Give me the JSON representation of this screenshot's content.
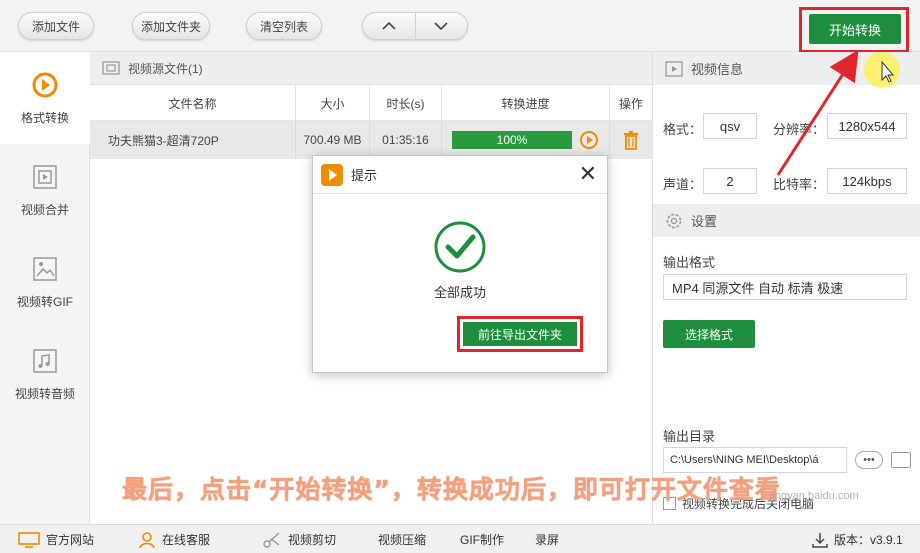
{
  "toolbar": {
    "add_file": "添加文件",
    "add_folder": "添加文件夹",
    "clear_list": "清空列表",
    "up_arrow": "︿",
    "down_arrow": "﹀",
    "start_convert": "开始转换"
  },
  "nav": {
    "items": [
      {
        "label": "格式转换",
        "icon": "play-circle-icon"
      },
      {
        "label": "视频合并",
        "icon": "video-merge-icon"
      },
      {
        "label": "视频转GIF",
        "icon": "image-icon"
      },
      {
        "label": "视频转音频",
        "icon": "music-note-icon"
      }
    ]
  },
  "files": {
    "header": "视频源文件(1)",
    "columns": [
      "文件名称",
      "大小",
      "时长(s)",
      "转换进度",
      "操作"
    ],
    "rows": [
      {
        "name": "功夫熊猫3-超清720P",
        "size": "700.49 MB",
        "duration": "01:35:16",
        "progress": "100%",
        "progress_value": 100
      }
    ]
  },
  "video_info": {
    "header": "视频信息",
    "format_label": "格式：",
    "format_value": "qsv",
    "resolution_label": "分辨率：",
    "resolution_value": "1280x544",
    "channel_label": "声道：",
    "channel_value": "2",
    "bitrate_label": "比特率：",
    "bitrate_value": "124kbps"
  },
  "settings": {
    "header": "设置",
    "output_format_label": "输出格式",
    "output_format_value": "MP4 同源文件 自动 标清 极速",
    "select_format": "选择格式",
    "output_dir_label": "输出目录",
    "output_dir_value": "C:\\Users\\NING MEI\\Desktop\\á",
    "more_button": "•••",
    "after_done_label": "视频转换完成后关闭电脑"
  },
  "bottombar": {
    "website": "官方网站",
    "service": "在线客服",
    "video_cut": "视频剪切",
    "video_compress": "视频压缩",
    "gif_make": "GIF制作",
    "record": "录屏",
    "version": "版本：v3.9.1"
  },
  "dialog": {
    "title": "提示",
    "close": "✕",
    "message": "全部成功",
    "button": "前往导出文件夹"
  },
  "overlay": {
    "caption": "最后，点击“开始转换”，转换成功后，即可打开文件查看",
    "watermark": "jingyan.baidu.com"
  },
  "colors": {
    "accent_green": "#1e8e3e",
    "highlight_red": "#e0262a",
    "orange": "#f08c00",
    "caption": "#f4a07d"
  }
}
